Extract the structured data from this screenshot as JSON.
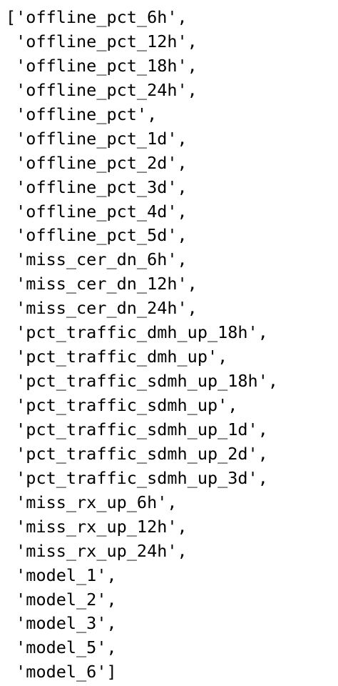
{
  "output": {
    "lines": [
      "['offline_pct_6h',",
      " 'offline_pct_12h',",
      " 'offline_pct_18h',",
      " 'offline_pct_24h',",
      " 'offline_pct',",
      " 'offline_pct_1d',",
      " 'offline_pct_2d',",
      " 'offline_pct_3d',",
      " 'offline_pct_4d',",
      " 'offline_pct_5d',",
      " 'miss_cer_dn_6h',",
      " 'miss_cer_dn_12h',",
      " 'miss_cer_dn_24h',",
      " 'pct_traffic_dmh_up_18h',",
      " 'pct_traffic_dmh_up',",
      " 'pct_traffic_sdmh_up_18h',",
      " 'pct_traffic_sdmh_up',",
      " 'pct_traffic_sdmh_up_1d',",
      " 'pct_traffic_sdmh_up_2d',",
      " 'pct_traffic_sdmh_up_3d',",
      " 'miss_rx_up_6h',",
      " 'miss_rx_up_12h',",
      " 'miss_rx_up_24h',",
      " 'model_1',",
      " 'model_2',",
      " 'model_3',",
      " 'model_5',",
      " 'model_6']"
    ]
  }
}
